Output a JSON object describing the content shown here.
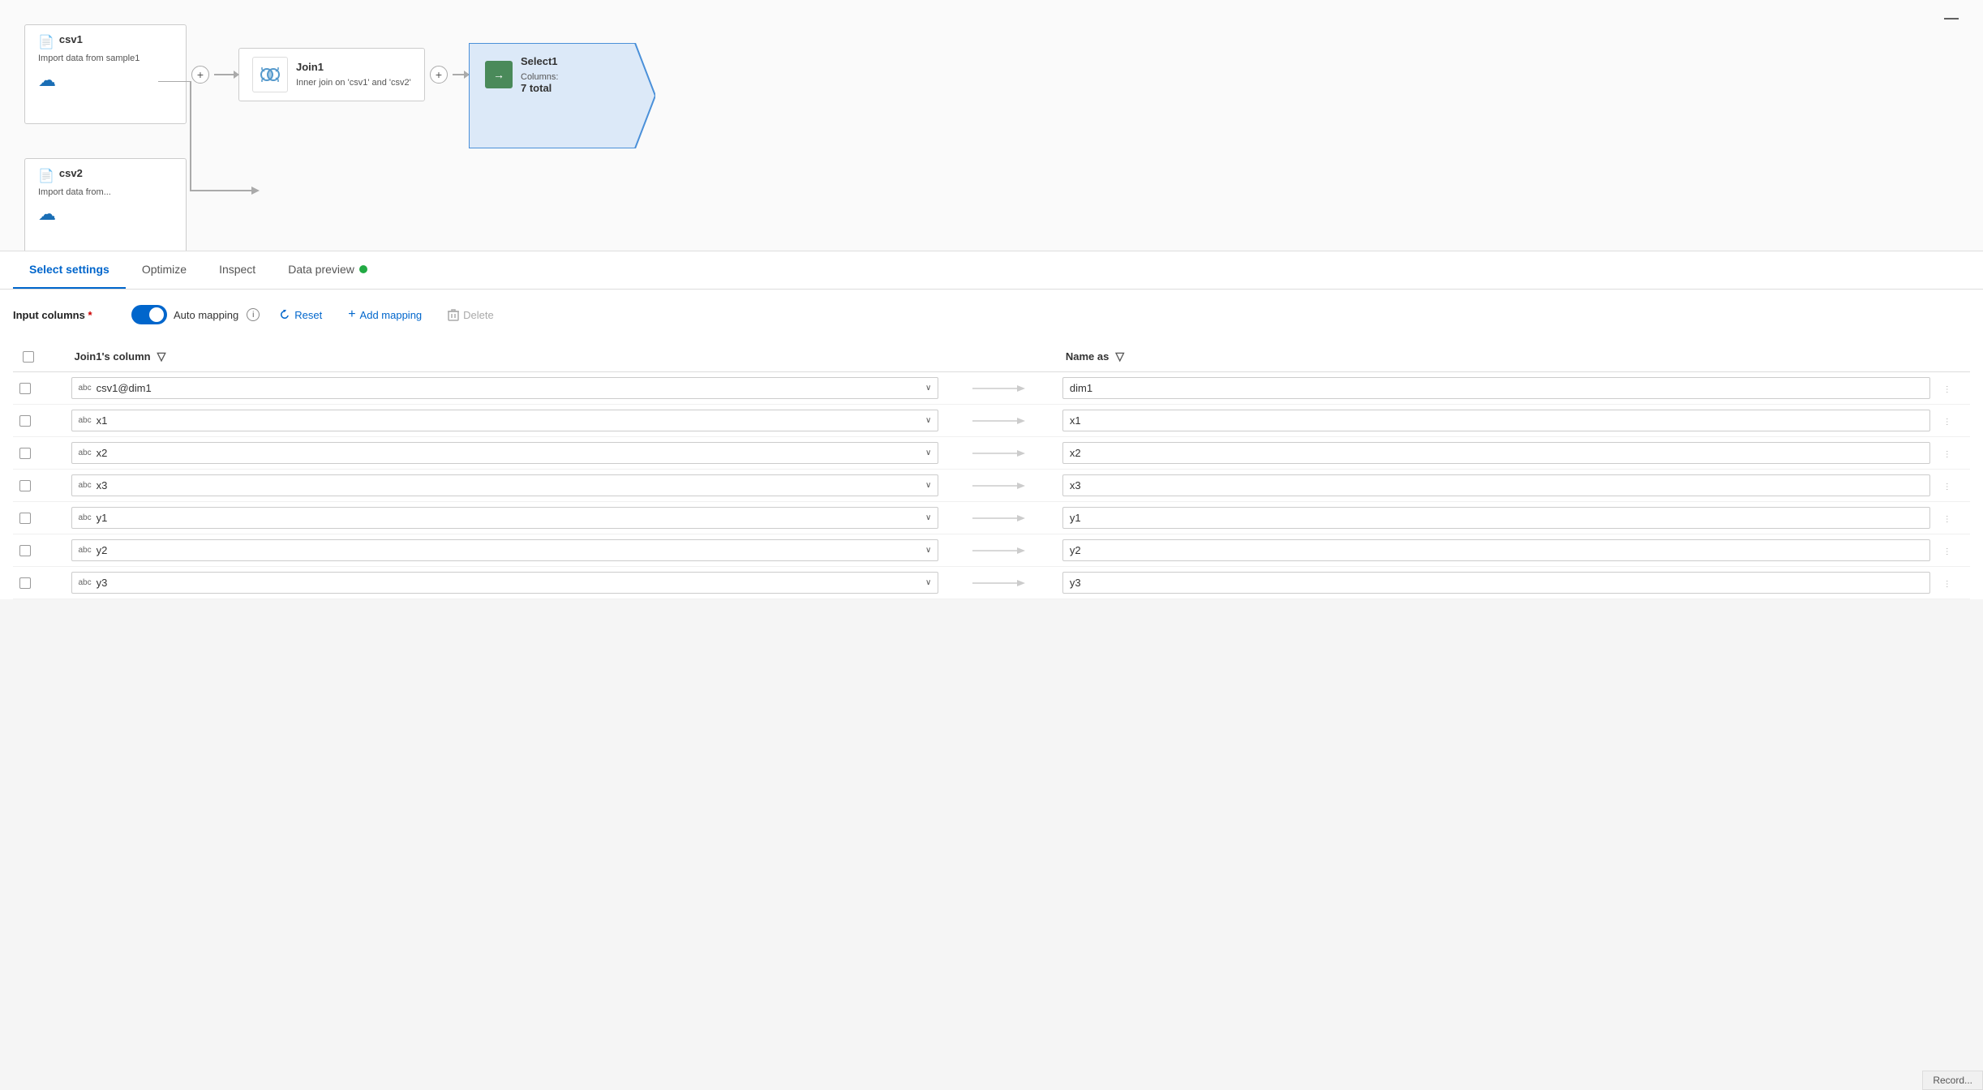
{
  "canvas": {
    "minus_label": "—",
    "nodes": [
      {
        "id": "csv1",
        "title": "csv1",
        "subtitle": "Import data from sample1",
        "type": "csv"
      },
      {
        "id": "join1",
        "title": "Join1",
        "subtitle": "Inner join on 'csv1' and 'csv2'",
        "type": "join"
      },
      {
        "id": "select1",
        "title": "Select1",
        "columns_label": "Columns:",
        "total_label": "7 total",
        "type": "select"
      }
    ],
    "csv2": {
      "title": "csv2",
      "subtitle": "Import data from..."
    },
    "plus_labels": [
      "+",
      "+",
      "+"
    ]
  },
  "tabs": [
    {
      "id": "select-settings",
      "label": "Select settings",
      "active": true
    },
    {
      "id": "optimize",
      "label": "Optimize",
      "active": false
    },
    {
      "id": "inspect",
      "label": "Inspect",
      "active": false
    },
    {
      "id": "data-preview",
      "label": "Data preview",
      "active": false,
      "has_dot": true
    }
  ],
  "settings": {
    "input_label": "Input columns",
    "required_marker": "*",
    "auto_mapping_label": "Auto mapping",
    "reset_label": "Reset",
    "add_mapping_label": "Add mapping",
    "delete_label": "Delete",
    "column_header": "Join1's column",
    "name_as_header": "Name as",
    "rows": [
      {
        "source": "csv1@dim1",
        "target": "dim1"
      },
      {
        "source": "x1",
        "target": "x1"
      },
      {
        "source": "x2",
        "target": "x2"
      },
      {
        "source": "x3",
        "target": "x3"
      },
      {
        "source": "y1",
        "target": "y1"
      },
      {
        "source": "y2",
        "target": "y2"
      },
      {
        "source": "y3",
        "target": "y3"
      }
    ]
  },
  "record_badge": "Record..."
}
